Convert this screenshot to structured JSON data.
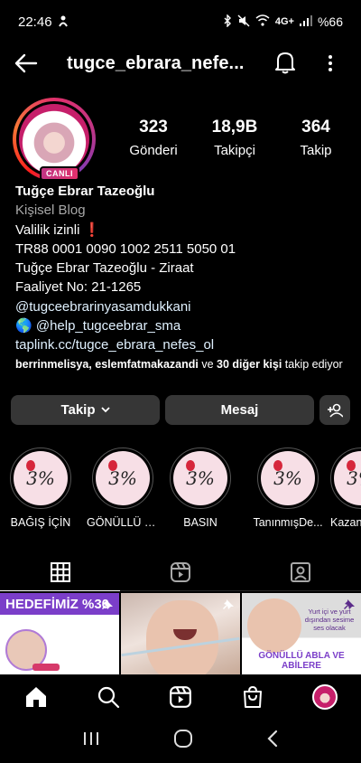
{
  "status_bar": {
    "time": "22:46",
    "battery": "%66"
  },
  "header": {
    "username": "tugce_ebrara_nefe..."
  },
  "profile": {
    "live_badge": "CANLI",
    "stats": [
      {
        "value": "323",
        "label": "Gönderi"
      },
      {
        "value": "18,9B",
        "label": "Takipçi"
      },
      {
        "value": "364",
        "label": "Takip"
      }
    ]
  },
  "bio": {
    "name": "Tuğçe Ebrar Tazeoğlu",
    "category": "Kişisel Blog",
    "lines": [
      "Valilik izinli ❗",
      "TR88 0001 0090 1002 2511 5050 01",
      "Tuğçe Ebrar Tazeoğlu - Ziraat",
      "Faaliyet No: 21-1265",
      "@tugceebrarinyasamdukkani",
      "🌎 @help_tugceebrar_sma"
    ],
    "link": "taplink.cc/tugce_ebrara_nefes_ol",
    "followed_by_users": "berrinmelisya, eslemfatmakazandi",
    "followed_by_mid": " ve ",
    "followed_by_others": "30 diğer kişi",
    "followed_by_suffix": " takip ediyor"
  },
  "actions": {
    "follow_label": "Takip",
    "message_label": "Mesaj"
  },
  "highlights": [
    {
      "label": "BAĞIŞ İÇİN"
    },
    {
      "label": "GÖNÜLLÜ O..."
    },
    {
      "label": "BASIN"
    },
    {
      "label": "TanınmışDe..."
    },
    {
      "label": "Kazan"
    }
  ],
  "grid": {
    "post1_banner": "HEDEFİMİZ %30",
    "post3_text": "Yurt içi ve yurt dışından sesime ses olacak",
    "post3_title": "GÖNÜLLÜ ABLA VE ABİLERE"
  },
  "colors": {
    "background": "#000000",
    "button": "#363636",
    "accent_live": "#e1306c",
    "link": "#e0f1ff"
  }
}
